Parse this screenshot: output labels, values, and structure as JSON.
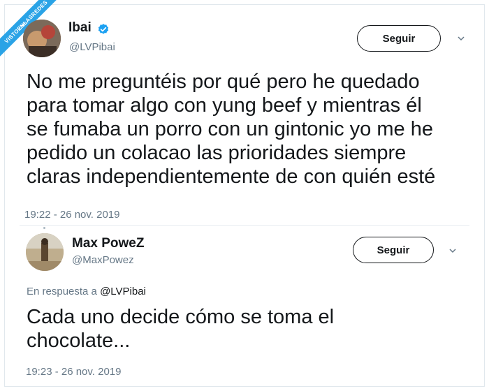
{
  "watermark": {
    "text": "VISTOENLASREDES",
    "sub": ".com"
  },
  "tweet1": {
    "name": "Ibai",
    "handle": "@LVPibai",
    "follow_label": "Seguir",
    "lines": [
      "No me preguntéis por qué pero he quedado",
      "para tomar algo con yung beef y mientras él",
      "se fumaba un porro con un gintonic yo me he",
      "pedido un colacao las prioridades siempre",
      "claras independientemente de con quién esté"
    ],
    "timestamp": "19:22 - 26 nov. 2019"
  },
  "tweet2": {
    "name": "Max PoweZ",
    "handle": "@MaxPowez",
    "follow_label": "Seguir",
    "reply_prefix": "En respuesta a",
    "reply_mention": "@LVPibai",
    "lines": [
      "Cada uno decide cómo se toma el",
      "chocolate..."
    ],
    "timestamp": "19:23 - 26 nov. 2019"
  },
  "colors": {
    "verified": "#1da1f2",
    "text": "#14171a",
    "muted": "#657786",
    "badge": "#2aa3e6"
  },
  "icons": {
    "verified": "verified-badge-icon",
    "chevron": "chevron-down-icon"
  }
}
